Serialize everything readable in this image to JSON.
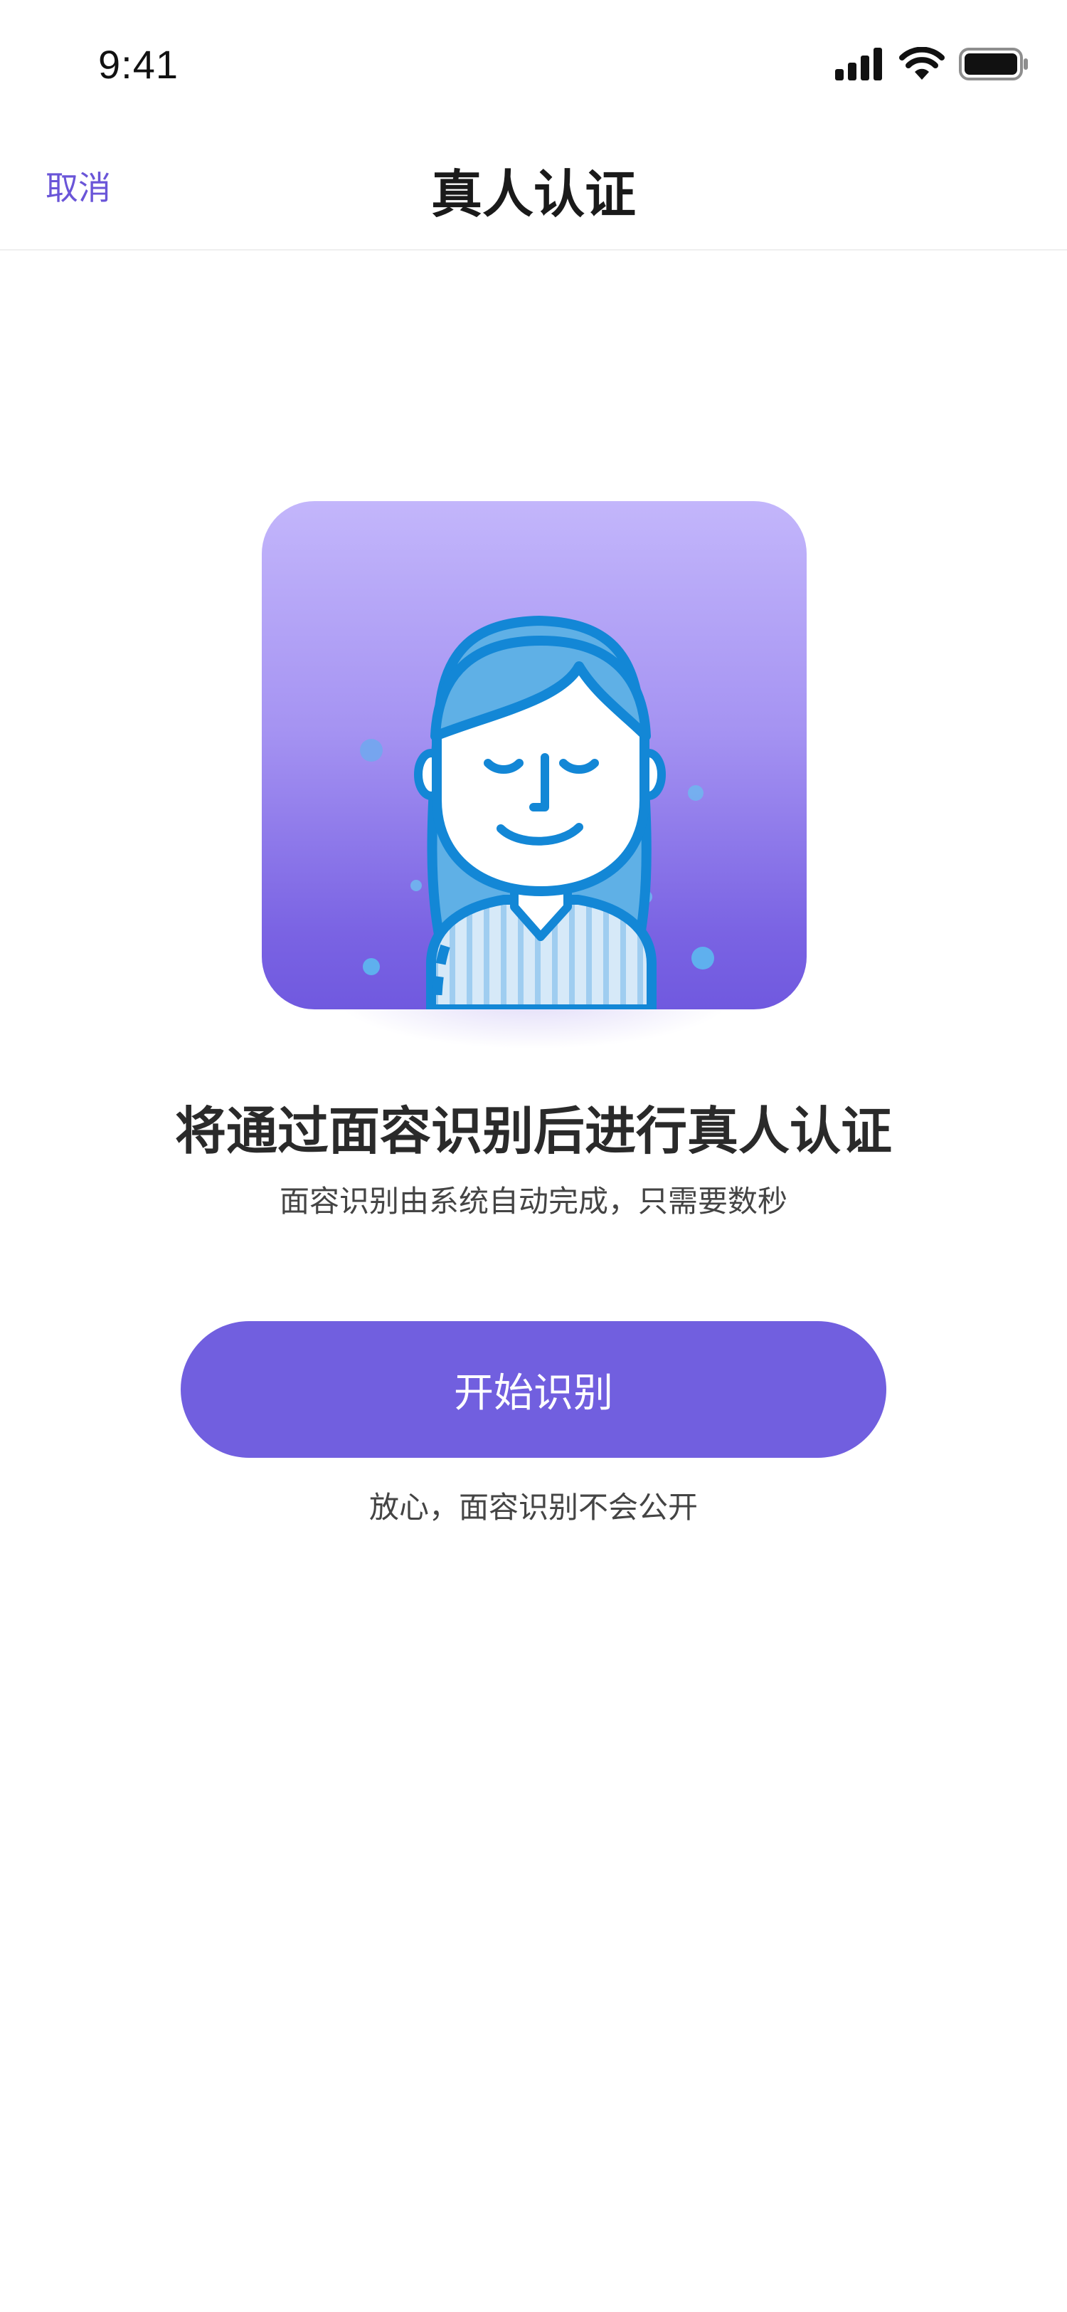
{
  "status_bar": {
    "time": "9:41",
    "icons": [
      "signal-icon",
      "wifi-icon",
      "battery-icon"
    ]
  },
  "nav": {
    "cancel_label": "取消",
    "title": "真人认证"
  },
  "illustration": {
    "subject": "face-avatar-icon",
    "colors": {
      "card_top": "#c3b6fb",
      "card_bottom": "#7059df",
      "outline": "#1387d6",
      "hair": "#5fb0e6",
      "skin": "#ffffff"
    }
  },
  "main": {
    "headline": "将通过面容识别后进行真人认证",
    "subline": "面容识别由系统自动完成，只需要数秒",
    "start_button_label": "开始识别",
    "reassure_text": "放心，面容识别不会公开"
  },
  "theme": {
    "accent": "#715fdf",
    "link": "#6a55d8"
  }
}
